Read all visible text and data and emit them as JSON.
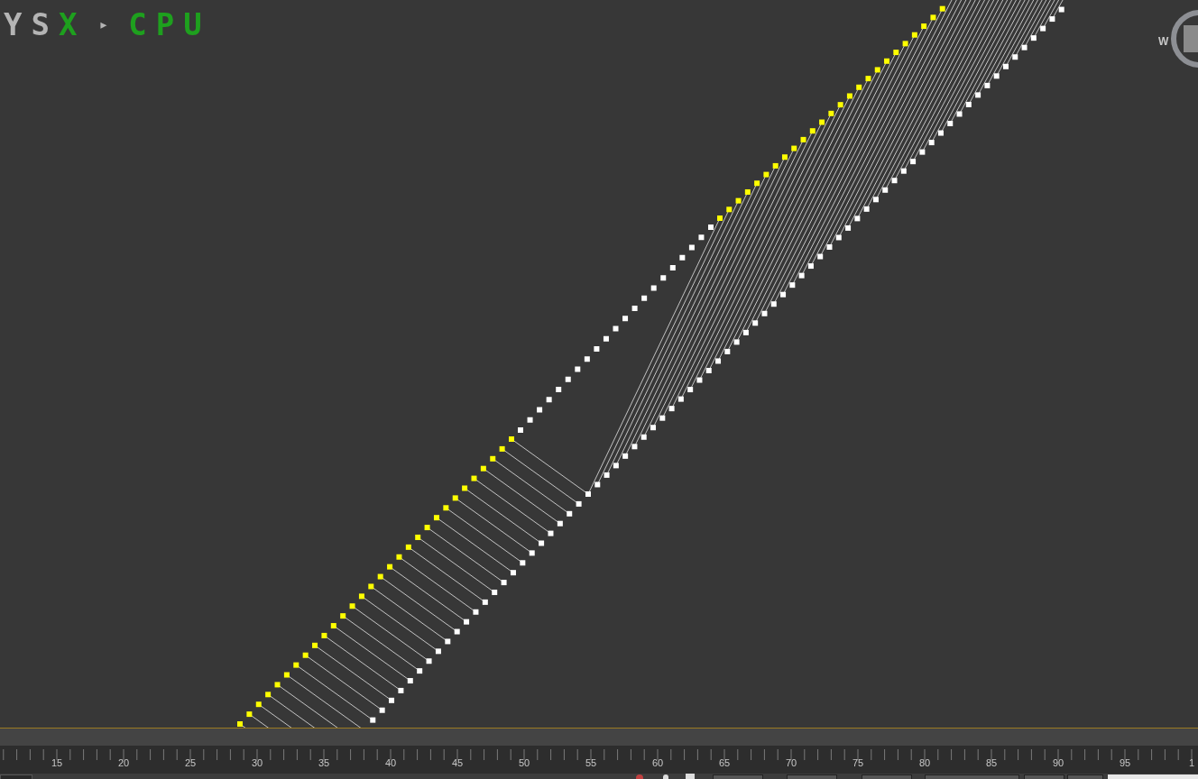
{
  "viewport": {
    "label": {
      "prefix": "YS",
      "engine": "X",
      "arrow": "▸",
      "mode": "CPU"
    },
    "viewcube": {
      "west": "W"
    }
  },
  "timeline": {
    "labels": [
      "15",
      "20",
      "25",
      "30",
      "35",
      "40",
      "45",
      "50",
      "55",
      "60",
      "65",
      "70",
      "75",
      "80",
      "85",
      "90",
      "95",
      "1"
    ]
  }
}
